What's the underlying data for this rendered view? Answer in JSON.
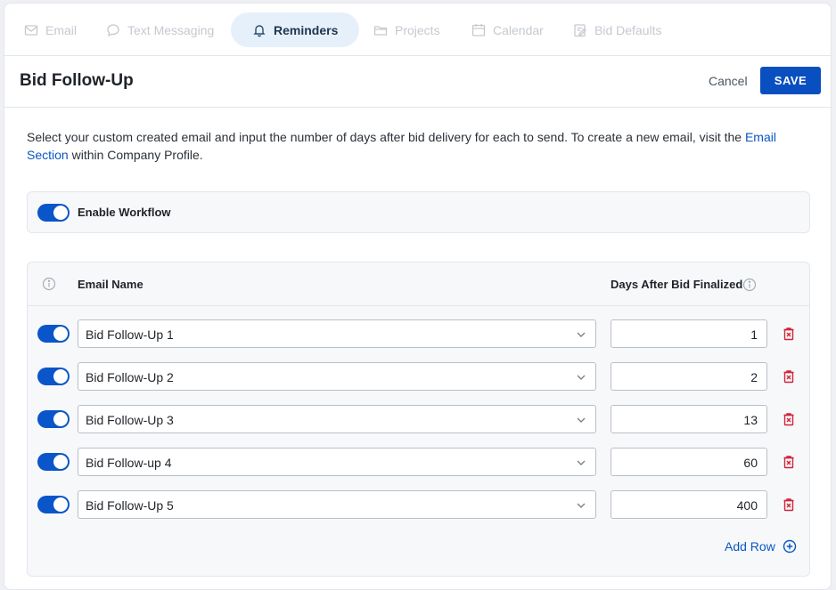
{
  "tabs": [
    {
      "label": "Email",
      "icon": "mail-icon"
    },
    {
      "label": "Text Messaging",
      "icon": "chat-icon"
    },
    {
      "label": "Reminders",
      "icon": "bell-icon",
      "active": true
    },
    {
      "label": "Projects",
      "icon": "folder-icon"
    },
    {
      "label": "Calendar",
      "icon": "calendar-icon"
    },
    {
      "label": "Bid Defaults",
      "icon": "document-edit-icon"
    }
  ],
  "header": {
    "title": "Bid Follow-Up",
    "cancel_label": "Cancel",
    "save_label": "SAVE"
  },
  "intro": {
    "text_before": "Select your custom created email and input the number of days after bid delivery for each to send. To create a new email, visit the ",
    "link_text": "Email Section",
    "text_after": " within Company Profile."
  },
  "workflow": {
    "label": "Enable Workflow",
    "enabled": true
  },
  "table": {
    "columns": {
      "email_name": "Email Name",
      "days_after": "Days After Bid Finalized"
    },
    "rows": [
      {
        "enabled": true,
        "email": "Bid Follow-Up 1",
        "days": "1"
      },
      {
        "enabled": true,
        "email": "Bid Follow-Up 2",
        "days": "2"
      },
      {
        "enabled": true,
        "email": "Bid Follow-Up 3",
        "days": "13"
      },
      {
        "enabled": true,
        "email": "Bid Follow-up 4",
        "days": "60"
      },
      {
        "enabled": true,
        "email": "Bid Follow-Up 5",
        "days": "400"
      }
    ],
    "add_row_label": "Add Row"
  },
  "colors": {
    "accent": "#0a4fbf",
    "link": "#0a56c2",
    "danger": "#d0243a",
    "active_tab_bg": "#e6f0fb"
  }
}
